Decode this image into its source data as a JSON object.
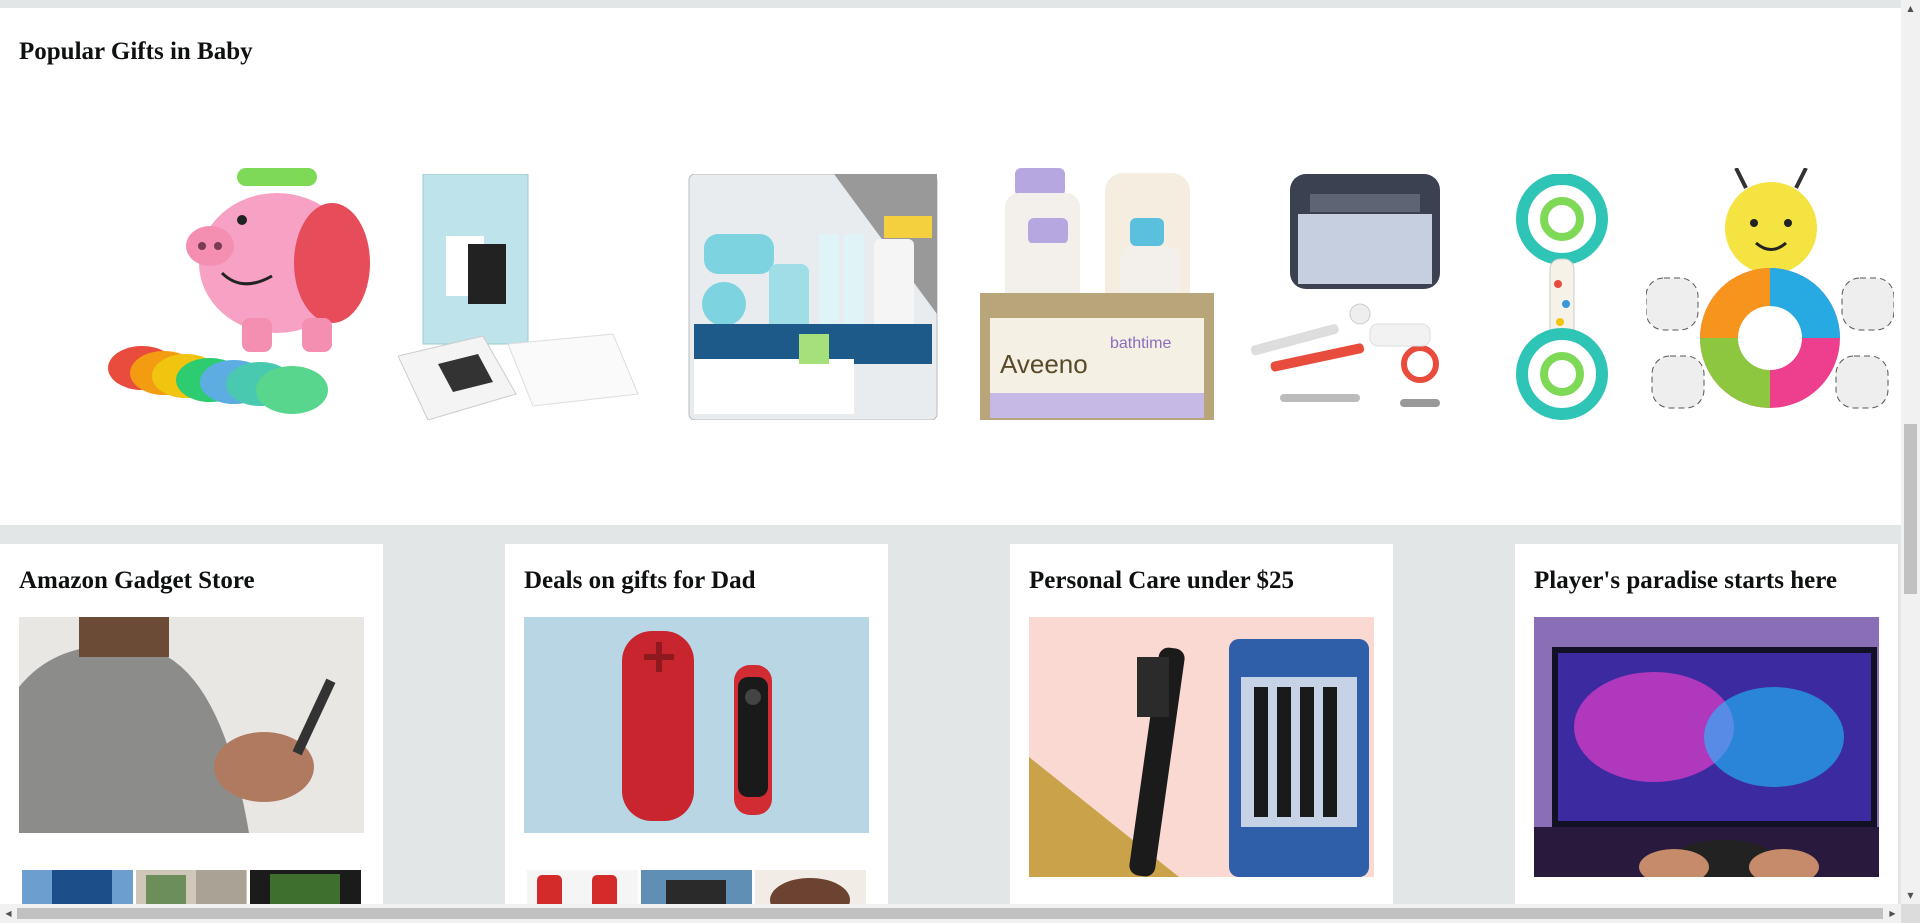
{
  "popular": {
    "title": "Popular Gifts in Baby",
    "products": [
      {
        "icon": "piggy-bank-toy"
      },
      {
        "icon": "handprint-kit"
      },
      {
        "icon": "healthcare-grooming-kit"
      },
      {
        "icon": "aveeno-gift-set"
      },
      {
        "icon": "grooming-kit-bag"
      },
      {
        "icon": "rattle-toy"
      },
      {
        "icon": "caterpillar-plush"
      }
    ]
  },
  "cards": [
    {
      "title": "Amazon Gadget Store",
      "hero_icon": "person-using-phone"
    },
    {
      "title": "Deals on gifts for Dad",
      "hero_icon": "speaker-and-remote"
    },
    {
      "title": "Personal Care under $25",
      "hero_icon": "toothbrushes"
    },
    {
      "title": "Player's paradise starts here",
      "hero_icon": "gaming-tv"
    }
  ],
  "colors": {
    "page_bg": "#e3e6e6",
    "card_bg": "#ffffff",
    "text": "#0f1111"
  }
}
